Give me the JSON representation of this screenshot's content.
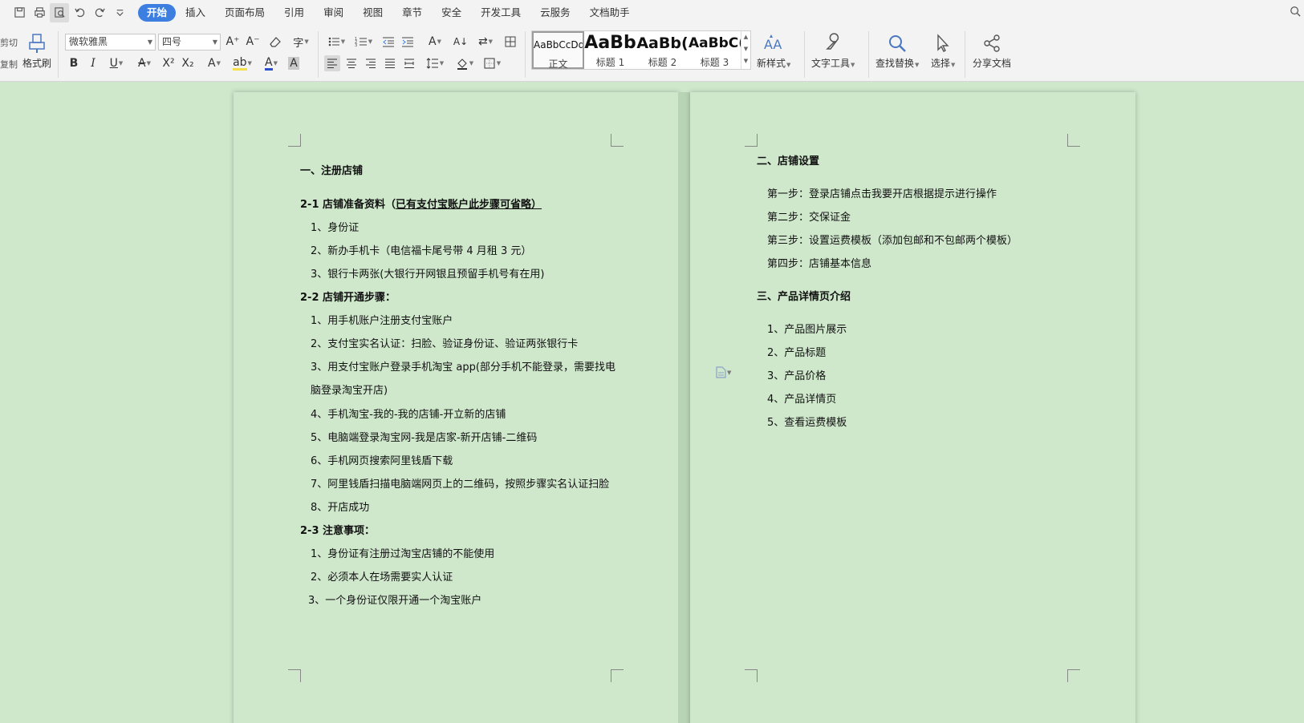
{
  "menubar": {
    "tabs": [
      "开始",
      "插入",
      "页面布局",
      "引用",
      "审阅",
      "视图",
      "章节",
      "安全",
      "开发工具",
      "云服务",
      "文档助手"
    ]
  },
  "ribbon": {
    "clipboard_cut": "剪切",
    "clipboard_copy": "复制",
    "format_painter": "格式刷",
    "font_name": "微软雅黑",
    "font_size": "四号",
    "styles": [
      {
        "preview": "AaBbCcDd",
        "label": "正文"
      },
      {
        "preview": "AaBb",
        "label": "标题 1"
      },
      {
        "preview": "AaBb(",
        "label": "标题 2"
      },
      {
        "preview": "AaBbC(",
        "label": "标题 3"
      }
    ],
    "new_style": "新样式",
    "text_tools": "文字工具",
    "find_replace": "查找替换",
    "select": "选择",
    "share_doc": "分享文档"
  },
  "doc": {
    "page1": [
      {
        "text": "一、注册店铺",
        "bold": true
      },
      {
        "text": "2-1 店铺准备资料（",
        "bold": true,
        "underlined": "已有支付宝账户此步骤可省略）"
      },
      {
        "text": "1、身份证"
      },
      {
        "text": "2、新办手机卡（电信福卡尾号带 4 月租 3 元）"
      },
      {
        "text": "3、银行卡两张(大银行开网银且预留手机号有在用)"
      },
      {
        "text": "2-2 店铺开通步骤：",
        "bold": true
      },
      {
        "text": "1、用手机账户注册支付宝账户"
      },
      {
        "text": "2、支付宝实名认证：扫脸、验证身份证、验证两张银行卡"
      },
      {
        "text": "3、用支付宝账户登录手机淘宝 app(部分手机不能登录，需要找电"
      },
      {
        "text": "脑登录淘宝开店)"
      },
      {
        "text": "4、手机淘宝-我的-我的店铺-开立新的店铺"
      },
      {
        "text": "5、电脑端登录淘宝网-我是店家-新开店铺-二维码"
      },
      {
        "text": "6、手机网页搜索阿里钱盾下载"
      },
      {
        "text": "7、阿里钱盾扫描电脑端网页上的二维码，按照步骤实名认证扫脸"
      },
      {
        "text": "8、开店成功"
      },
      {
        "text": "2-3 注意事项：",
        "bold": true
      },
      {
        "text": "1、身份证有注册过淘宝店铺的不能使用"
      },
      {
        "text": "2、必须本人在场需要实人认证"
      },
      {
        "text": "3、一个身份证仅限开通一个淘宝账户"
      }
    ],
    "page2": [
      {
        "text": "二、店铺设置",
        "bold": true
      },
      {
        "text": "第一步：登录店铺点击我要开店根据提示进行操作"
      },
      {
        "text": "第二步：交保证金"
      },
      {
        "text": "第三步：设置运费模板（添加包邮和不包邮两个模板）"
      },
      {
        "text": "第四步：店铺基本信息"
      },
      {
        "text": "三、产品详情页介绍",
        "bold": true
      },
      {
        "text": "1、产品图片展示"
      },
      {
        "text": "2、产品标题"
      },
      {
        "text": "3、产品价格"
      },
      {
        "text": "4、产品详情页"
      },
      {
        "text": "5、查看运费模板"
      }
    ]
  }
}
